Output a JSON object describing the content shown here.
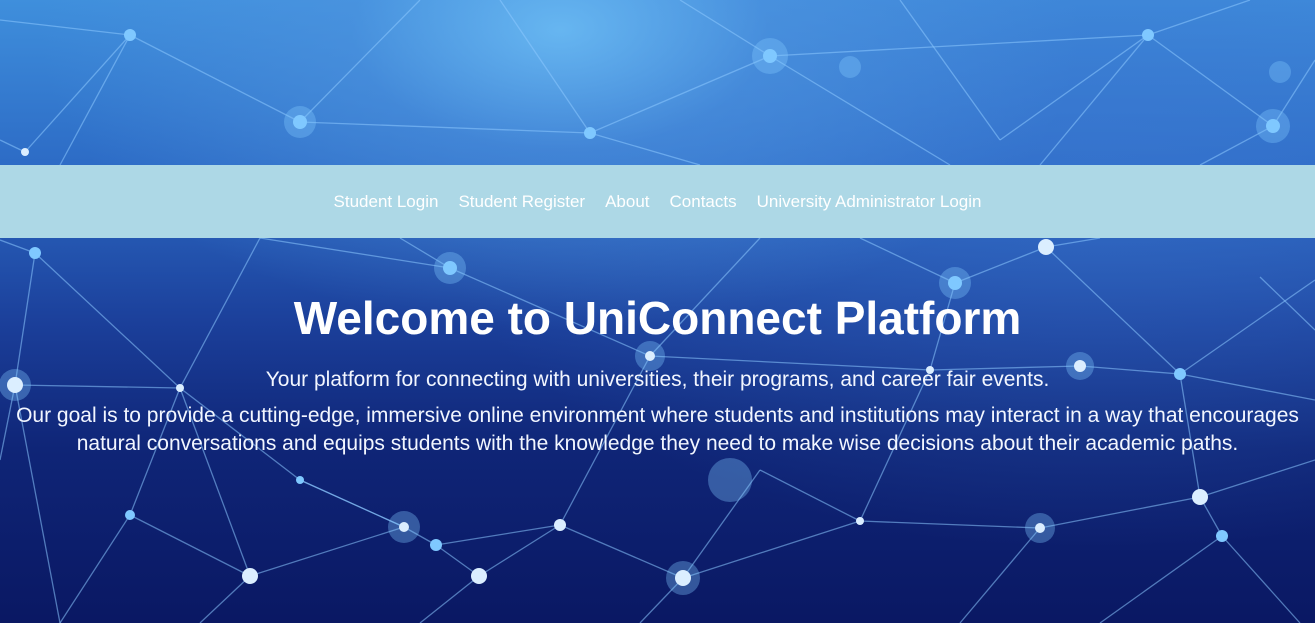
{
  "nav": {
    "items": [
      {
        "label": "Student Login"
      },
      {
        "label": "Student Register"
      },
      {
        "label": "About"
      },
      {
        "label": "Contacts"
      },
      {
        "label": "University Administrator Login"
      }
    ],
    "background_color": "#add8e6"
  },
  "hero": {
    "title": "Welcome to UniConnect Platform",
    "subtitle": "Your platform for connecting with universities, their programs, and career fair events.",
    "description": "Our goal is to provide a cutting-edge, immersive online environment where students and institutions may interact in a way that encourages natural conversations and equips students with the knowledge they need to make wise decisions about their academic paths."
  },
  "background": {
    "image": "network-background",
    "colors": [
      "#3f8fdc",
      "#1b3f9a",
      "#0a1863"
    ]
  }
}
